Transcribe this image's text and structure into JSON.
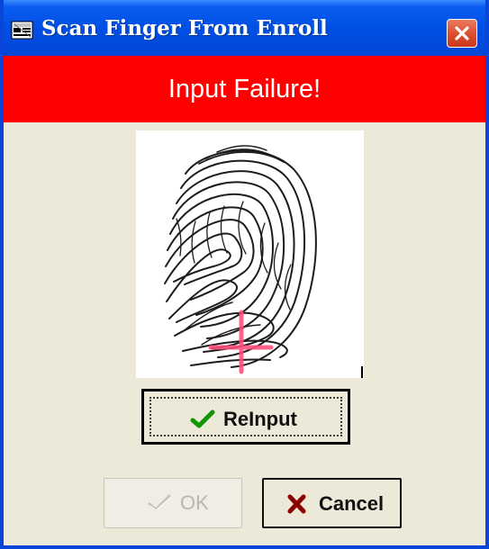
{
  "window": {
    "title": "Scan Finger From Enroll",
    "icon": "window-app-icon",
    "close_icon": "close-icon"
  },
  "status": {
    "message": "Input Failure!",
    "color": "#ff0000"
  },
  "fingerprint": {
    "image_type": "fingerprint-scan",
    "marker": "crosshair"
  },
  "buttons": {
    "reinput": {
      "label": "ReInput",
      "icon": "check-icon",
      "icon_color": "#149500"
    },
    "ok": {
      "label": "OK",
      "icon": "check-icon",
      "disabled": true
    },
    "cancel": {
      "label": "Cancel",
      "icon": "x-icon",
      "icon_color": "#8a0000"
    }
  },
  "colors": {
    "title_blue": "#0050e6",
    "window_bg": "#ece9d8",
    "crosshair": "#ff4d7c"
  }
}
